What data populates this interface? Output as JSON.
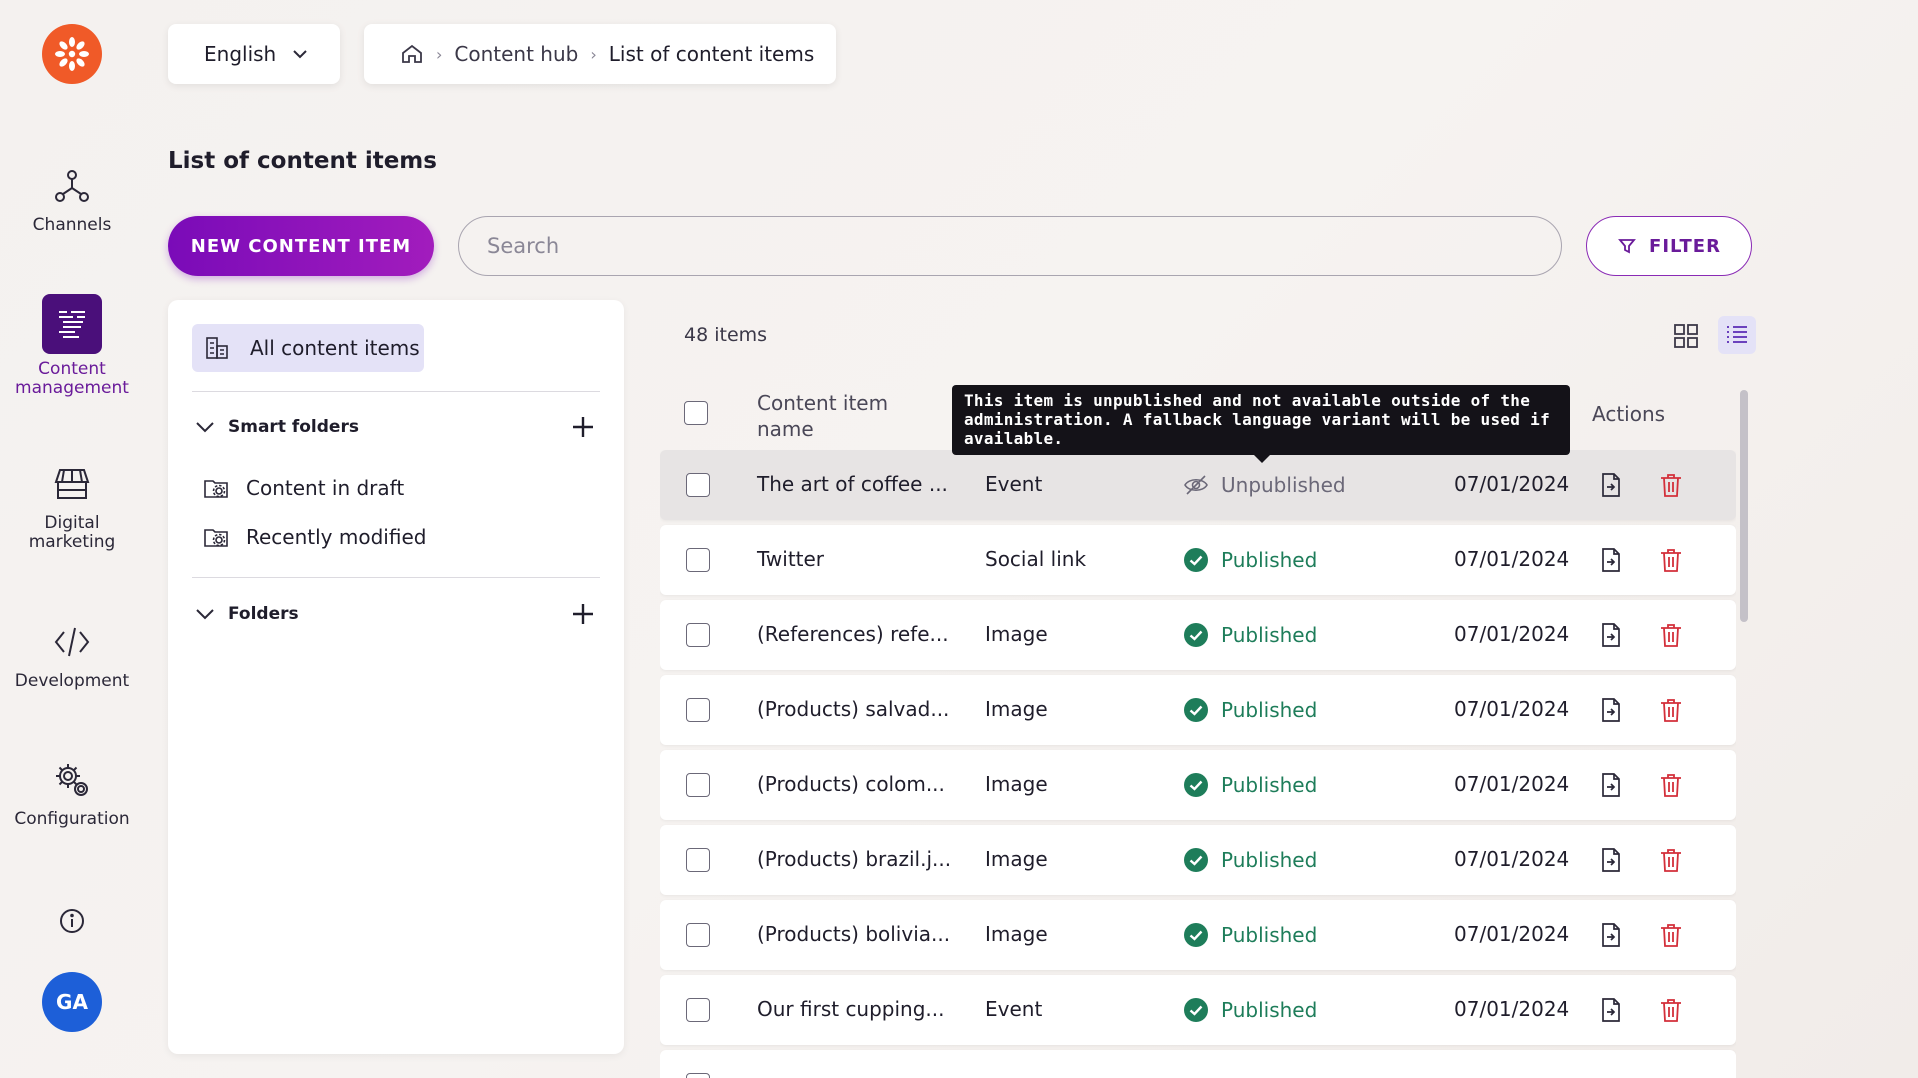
{
  "rail": {
    "items": [
      {
        "label": "Channels",
        "icon": "channels-icon"
      },
      {
        "label": "Content\nmanagement",
        "icon": "content-management-icon",
        "active": true
      },
      {
        "label": "Digital\nmarketing",
        "icon": "digital-marketing-icon"
      },
      {
        "label": "Development",
        "icon": "code-icon"
      },
      {
        "label": "Configuration",
        "icon": "gear-icon"
      }
    ],
    "avatar": "GA"
  },
  "topbar": {
    "language": "English",
    "breadcrumb": [
      "Content hub",
      "List of content items"
    ]
  },
  "page": {
    "title": "List of content items",
    "new_button": "NEW CONTENT ITEM",
    "search_placeholder": "Search",
    "filter_button": "FILTER"
  },
  "panel": {
    "all_items": "All content items",
    "smart_folders_title": "Smart folders",
    "smart_folders": [
      "Content in draft",
      "Recently modified"
    ],
    "folders_title": "Folders"
  },
  "list": {
    "count": "48 items",
    "columns": {
      "name": "Content item\nname",
      "actions": "Actions"
    },
    "tooltip": "This item is unpublished and not available outside of the administration. A fallback language variant will be used if available.",
    "rows": [
      {
        "name": "The art of coffee ...",
        "type": "Event",
        "status": "Unpublished",
        "date": "07/01/2024"
      },
      {
        "name": "Twitter",
        "type": "Social link",
        "status": "Published",
        "date": "07/01/2024"
      },
      {
        "name": "(References) refe...",
        "type": "Image",
        "status": "Published",
        "date": "07/01/2024"
      },
      {
        "name": "(Products) salvad...",
        "type": "Image",
        "status": "Published",
        "date": "07/01/2024"
      },
      {
        "name": "(Products) colom...",
        "type": "Image",
        "status": "Published",
        "date": "07/01/2024"
      },
      {
        "name": "(Products) brazil.j...",
        "type": "Image",
        "status": "Published",
        "date": "07/01/2024"
      },
      {
        "name": "(Products) bolivia...",
        "type": "Image",
        "status": "Published",
        "date": "07/01/2024"
      },
      {
        "name": "Our first cupping...",
        "type": "Event",
        "status": "Published",
        "date": "07/01/2024"
      }
    ]
  },
  "colors": {
    "accent": "#7a0bb8",
    "published": "#1e7d5a",
    "delete": "#d32f3a",
    "brand_logo": "#f05a28"
  }
}
